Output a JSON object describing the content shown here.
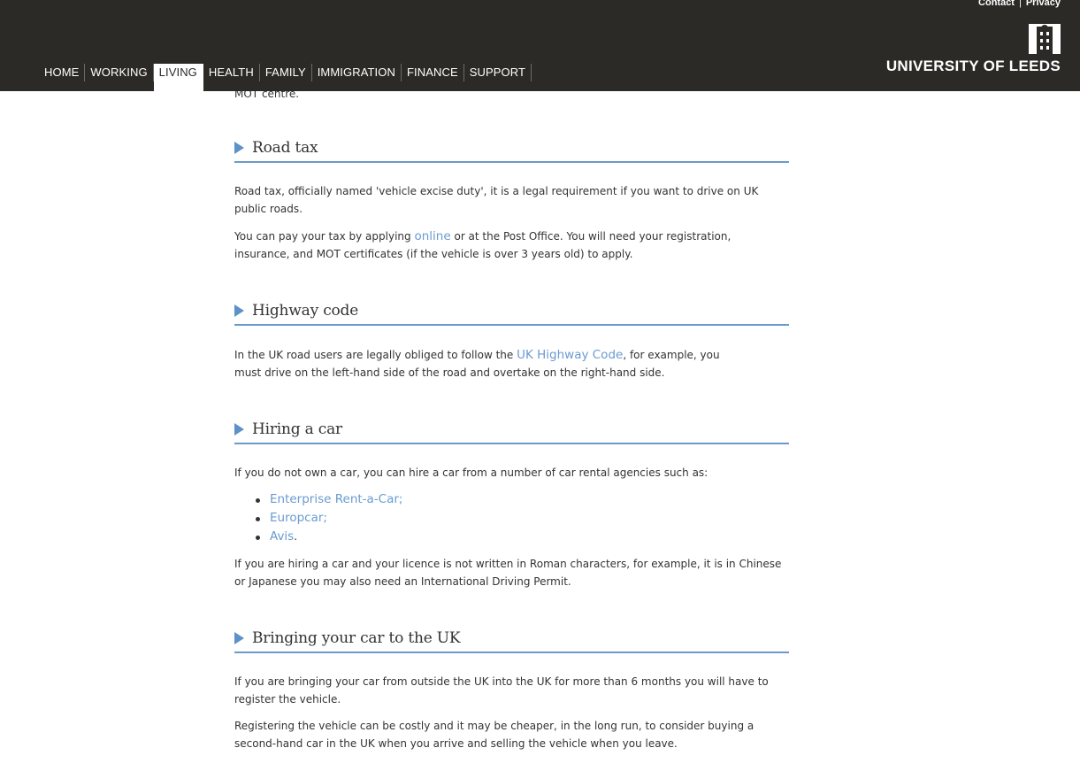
{
  "header": {
    "util_links": [
      "Contact",
      "Privacy"
    ],
    "util_sep": "|",
    "nav": [
      "HOME",
      "WORKING",
      "LIVING",
      "HEALTH",
      "FAMILY",
      "IMMIGRATION",
      "FINANCE",
      "SUPPORT"
    ],
    "active_nav": "LIVING",
    "logo_text": "UNIVERSITY OF LEEDS",
    "logo_icon": "parkinson-tower-icon"
  },
  "content": {
    "cut_text": "MOT centre.",
    "road_tax": {
      "title": "Road tax",
      "p1": "Road tax, officially named 'vehicle excise duty', it is a legal requirement if you want to drive on UK public roads.",
      "p2_before": "You can pay your tax by applying ",
      "p2_link": "online",
      "p2_after": " or at the Post Office.  You will need your registration, insurance, and MOT certificates (if the vehicle is over 3 years old) to apply."
    },
    "highway_code": {
      "title": "Highway code",
      "p1_before": "In the UK road users are legally obliged to follow the ",
      "p1_link": "UK Highway Code",
      "p1_after": ", for example, you",
      "p1_line2": "must drive on the left-hand side of the road and overtake on the right-hand side."
    },
    "hiring": {
      "title": "Hiring a car",
      "p1": "If you do not own a car, you can hire a car from a number of car rental agencies such as:",
      "agencies": [
        "Enterprise Rent-a-Car;",
        "Europcar;",
        "Avis"
      ],
      "agency_end": ".",
      "p2": "If you are hiring a car and your licence is not written in Roman characters, for example, it is in Chinese or Japanese you may also need an International Driving Permit."
    },
    "bringing": {
      "title": "Bringing your car to the UK",
      "p1": "If you are bringing your car from outside the UK into the UK for more than 6 months you will have to register the vehicle.",
      "p2": "Registering the vehicle can be costly and it may be cheaper, in the long run, to consider buying a second-hand car in the UK when you arrive and selling the vehicle when you leave."
    }
  },
  "colors": {
    "header_bg": "#2b2a27",
    "link": "#6a9bd0",
    "accent": "#5d92c7"
  }
}
